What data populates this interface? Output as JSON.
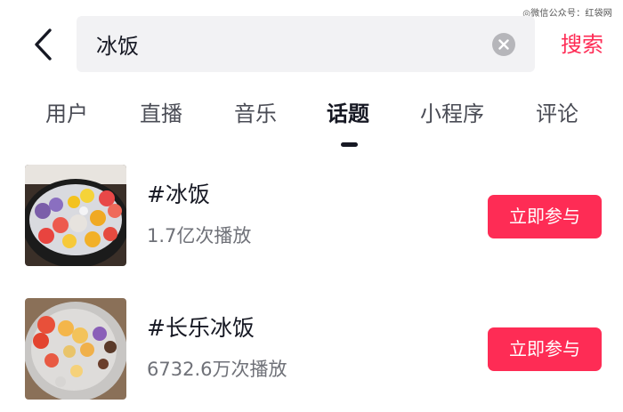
{
  "watermark": "◎微信公众号：红袋网",
  "header": {
    "search_value": "冰饭",
    "search_button_label": "搜索"
  },
  "tabs": [
    {
      "label": "用户",
      "active": false
    },
    {
      "label": "直播",
      "active": false
    },
    {
      "label": "音乐",
      "active": false
    },
    {
      "label": "话题",
      "active": true
    },
    {
      "label": "小程序",
      "active": false
    },
    {
      "label": "评论",
      "active": false
    }
  ],
  "results": [
    {
      "title": "#冰饭",
      "views": "1.7亿次播放",
      "button_label": "立即参与"
    },
    {
      "title": "#长乐冰饭",
      "views": "6732.6万次播放",
      "button_label": "立即参与"
    }
  ],
  "colors": {
    "accent": "#fe2c55",
    "text_primary": "#161823",
    "text_secondary": "#6f7178",
    "search_bg": "#f2f2f4"
  },
  "icons": {
    "back": "chevron-left-icon",
    "clear": "close-circle-icon"
  }
}
